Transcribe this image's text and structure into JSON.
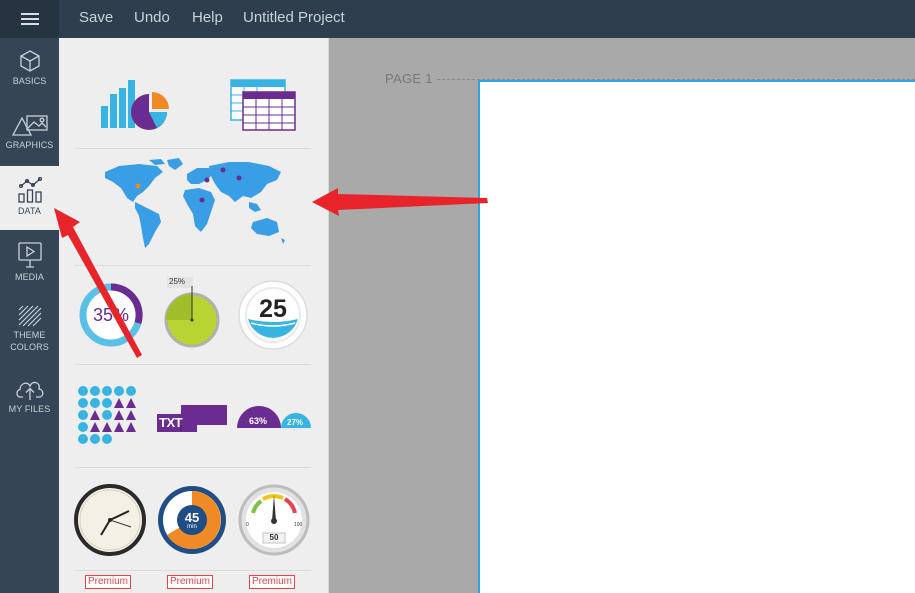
{
  "topbar": {
    "menu_icon": "hamburger-icon",
    "save_label": "Save",
    "undo_label": "Undo",
    "help_label": "Help",
    "project_title": "Untitled Project"
  },
  "sidebar": {
    "items": [
      {
        "label": "BASICS",
        "icon": "cube-icon"
      },
      {
        "label": "GRAPHICS",
        "icon": "shapes-icon"
      },
      {
        "label": "DATA",
        "icon": "chart-icon",
        "active": true
      },
      {
        "label": "MEDIA",
        "icon": "play-icon"
      },
      {
        "label_line1": "THEME",
        "label_line2": "COLORS",
        "icon": "stripes-icon"
      },
      {
        "label": "MY FILES",
        "icon": "cloud-upload-icon"
      }
    ]
  },
  "panel": {
    "progress_circle_value": "35%",
    "pie_timer_label": "25%",
    "counter_value": "25",
    "text_block_label": "TXT",
    "semi_gauge_1": "63%",
    "semi_gauge_2": "27%",
    "dial_value": "45",
    "dial_unit": "min",
    "speedometer_value": "50",
    "speedometer_min": "0",
    "speedometer_max": "100",
    "premium_label": "Premium"
  },
  "canvas": {
    "page_label": "PAGE 1"
  },
  "colors": {
    "topbar": "#2f3e4f",
    "sidebar": "#354555",
    "accent_blue": "#2fa6e0",
    "purple": "#6a2c91",
    "lime": "#b7d433",
    "orange": "#f08a24",
    "arrow_red": "#e8242a"
  }
}
